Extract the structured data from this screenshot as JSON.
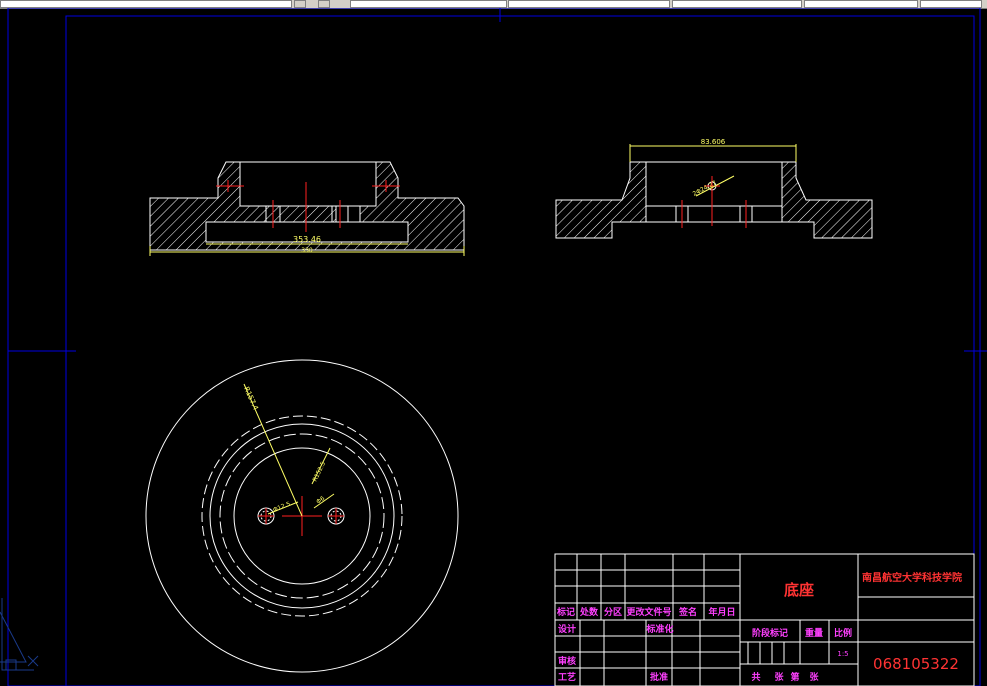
{
  "drawing": {
    "title_block": {
      "part_name": "底座",
      "school": "南昌航空大学科技学院",
      "row_labels": [
        "标记",
        "处数",
        "分区",
        "更改文件号",
        "签名",
        "年月日"
      ],
      "designer": "设计",
      "standardization": "标准化",
      "stage_mark": "阶段标记",
      "weight": "重量",
      "scale": "比例",
      "checker": "审核",
      "process": "工艺",
      "approve": "批准",
      "scale_value": "1:5",
      "sheet_info": [
        "共",
        "张",
        "第",
        "张"
      ],
      "drawing_number": "068105322"
    },
    "dimensions": {
      "front_inner": "353.46",
      "front_overall": "330",
      "side_top": "83.606",
      "side_hole": "2Φ24.27",
      "plan_radius": "R157.4",
      "plan_hole_left": "Φ12.5",
      "plan_hole_right": "Φ6",
      "plan_radius_inner": "R152.5"
    },
    "colors": {
      "background": "#000000",
      "frame": "#0000e0",
      "lines": "#ffffff",
      "centerline": "#ff2020",
      "dimension": "#ffff66",
      "hatch": "#ffffff",
      "label_magenta": "#ff40ff",
      "label_red": "#ff3333"
    }
  }
}
